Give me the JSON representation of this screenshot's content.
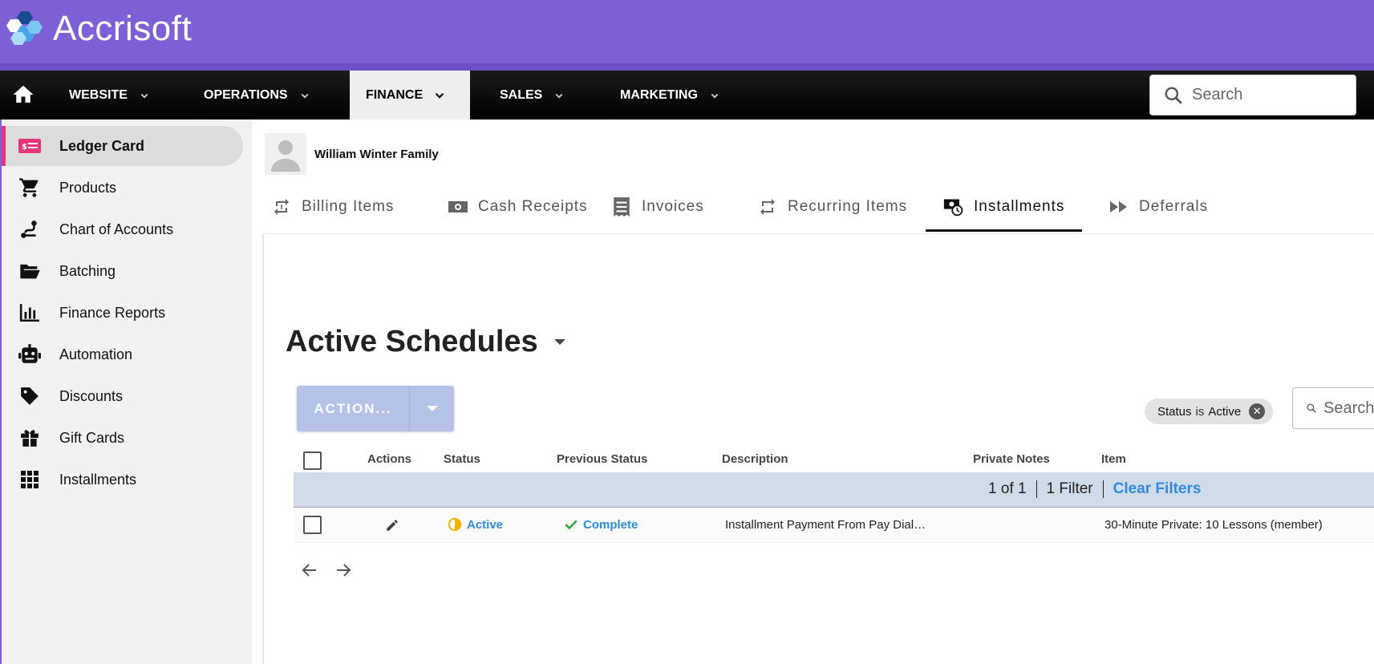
{
  "brand": {
    "name": "Accrisoft",
    "bar_color": "#7e5fd6"
  },
  "nav": {
    "items": [
      {
        "label": "WEBSITE"
      },
      {
        "label": "OPERATIONS"
      },
      {
        "label": "FINANCE"
      },
      {
        "label": "SALES"
      },
      {
        "label": "MARKETING"
      }
    ],
    "active": "FINANCE",
    "search_placeholder": "Search"
  },
  "sidebar": {
    "items": [
      {
        "label": "Ledger Card",
        "icon": "ledger-card-icon",
        "active": true
      },
      {
        "label": "Products",
        "icon": "cart-icon"
      },
      {
        "label": "Chart of Accounts",
        "icon": "route-icon"
      },
      {
        "label": "Batching",
        "icon": "folder-open-icon"
      },
      {
        "label": "Finance Reports",
        "icon": "bar-chart-icon"
      },
      {
        "label": "Automation",
        "icon": "robot-icon"
      },
      {
        "label": "Discounts",
        "icon": "tag-icon"
      },
      {
        "label": "Gift Cards",
        "icon": "gift-icon"
      },
      {
        "label": "Installments",
        "icon": "grid-icon"
      }
    ],
    "accent": "#e8347c"
  },
  "contact": {
    "name": "William Winter Family"
  },
  "tabs": [
    {
      "label": "Billing Items",
      "icon": "repeat-one-icon"
    },
    {
      "label": "Cash Receipts",
      "icon": "cash-icon"
    },
    {
      "label": "Invoices",
      "icon": "receipt-icon"
    },
    {
      "label": "Recurring Items",
      "icon": "repeat-icon"
    },
    {
      "label": "Installments",
      "icon": "installments-icon",
      "active": true
    },
    {
      "label": "Deferrals",
      "icon": "fast-forward-icon"
    }
  ],
  "section": {
    "title": "Active Schedules"
  },
  "toolbar": {
    "action_label": "ACTION...",
    "filter_chip": {
      "field": "Status",
      "op": "is",
      "value": "Active"
    },
    "search_placeholder": "Search"
  },
  "table": {
    "columns": [
      "Actions",
      "Status",
      "Previous Status",
      "Description",
      "Private Notes",
      "Item"
    ],
    "pagination": {
      "range": "1 of 1",
      "filters": "1 Filter",
      "clear_label": "Clear Filters"
    },
    "rows": [
      {
        "status": "Active",
        "previous_status": "Complete",
        "description": "Installment Payment From Pay Dial…",
        "private_notes": "",
        "item": "30-Minute Private: 10 Lessons (member)"
      }
    ]
  },
  "colors": {
    "link": "#2e8ce0",
    "action_button": "#b3c2e6",
    "filter_bar": "#cfdbe8"
  }
}
